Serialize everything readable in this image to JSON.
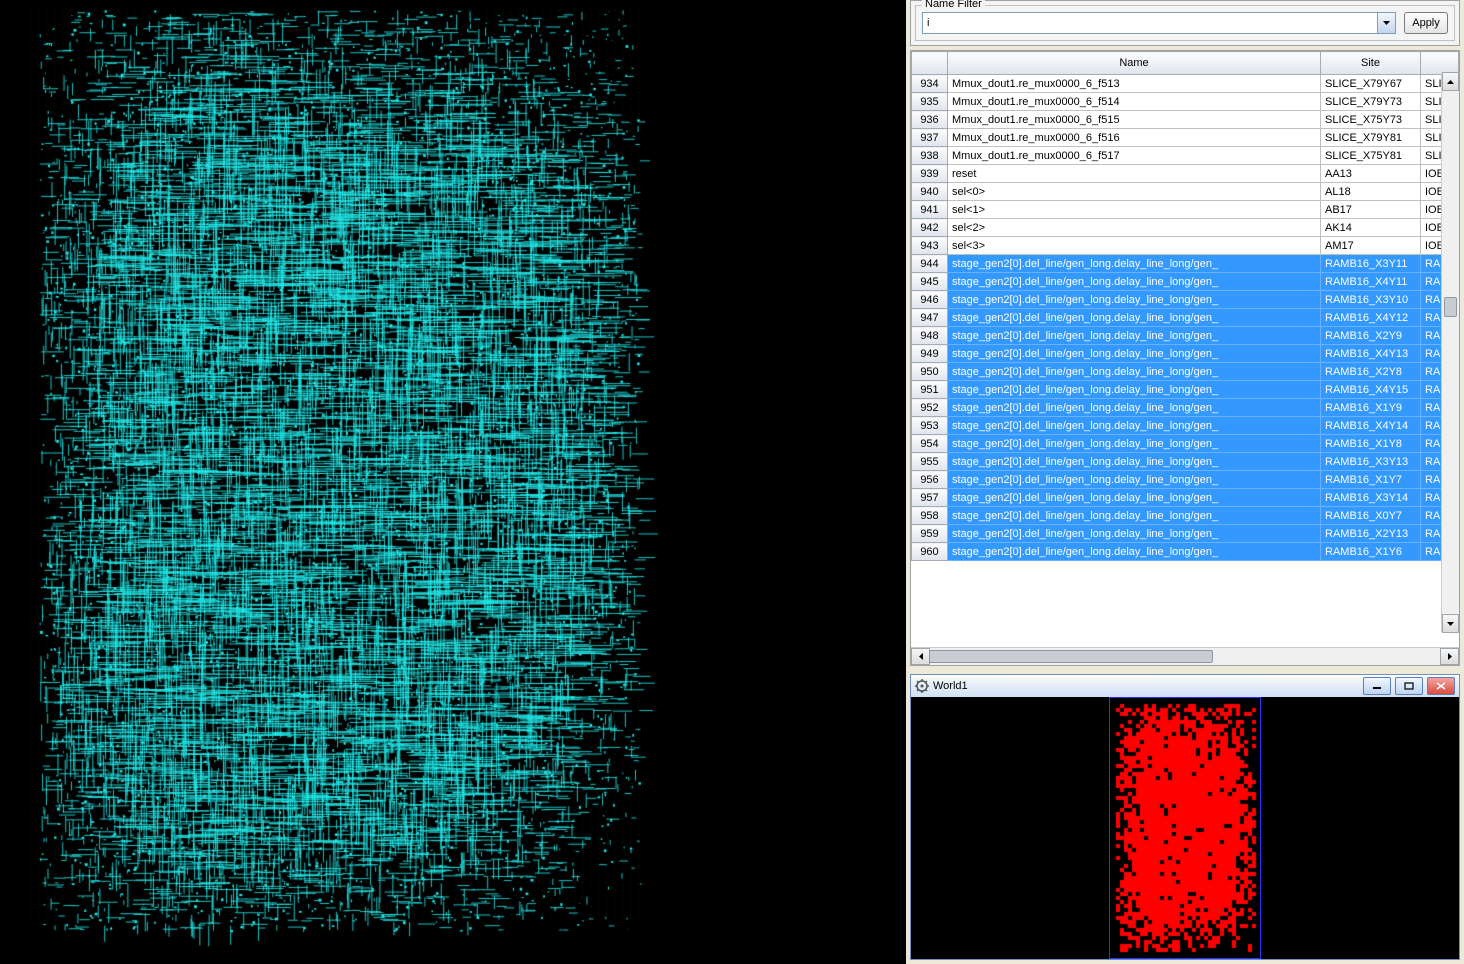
{
  "filter": {
    "legend": "Name Filter",
    "value": "i",
    "apply_label": "Apply"
  },
  "table": {
    "headers": {
      "name": "Name",
      "site": "Site",
      "type": ""
    },
    "rows": [
      {
        "n": 934,
        "name": "Mmux_dout1.re_mux0000_6_f513",
        "site": "SLICE_X79Y67",
        "type": "SLICI",
        "sel": false
      },
      {
        "n": 935,
        "name": "Mmux_dout1.re_mux0000_6_f514",
        "site": "SLICE_X79Y73",
        "type": "SLICI",
        "sel": false
      },
      {
        "n": 936,
        "name": "Mmux_dout1.re_mux0000_6_f515",
        "site": "SLICE_X75Y73",
        "type": "SLICI",
        "sel": false
      },
      {
        "n": 937,
        "name": "Mmux_dout1.re_mux0000_6_f516",
        "site": "SLICE_X79Y81",
        "type": "SLICI",
        "sel": false
      },
      {
        "n": 938,
        "name": "Mmux_dout1.re_mux0000_6_f517",
        "site": "SLICE_X75Y81",
        "type": "SLICI",
        "sel": false
      },
      {
        "n": 939,
        "name": "reset",
        "site": "AA13",
        "type": "IOB",
        "sel": false
      },
      {
        "n": 940,
        "name": "sel<0>",
        "site": "AL18",
        "type": "IOB",
        "sel": false
      },
      {
        "n": 941,
        "name": "sel<1>",
        "site": "AB17",
        "type": "IOB",
        "sel": false
      },
      {
        "n": 942,
        "name": "sel<2>",
        "site": "AK14",
        "type": "IOB",
        "sel": false
      },
      {
        "n": 943,
        "name": "sel<3>",
        "site": "AM17",
        "type": "IOB",
        "sel": false
      },
      {
        "n": 944,
        "name": "stage_gen2[0].del_line/gen_long.delay_line_long/gen_",
        "site": "RAMB16_X3Y11",
        "type": "RAM",
        "sel": true
      },
      {
        "n": 945,
        "name": "stage_gen2[0].del_line/gen_long.delay_line_long/gen_",
        "site": "RAMB16_X4Y11",
        "type": "RAM",
        "sel": true
      },
      {
        "n": 946,
        "name": "stage_gen2[0].del_line/gen_long.delay_line_long/gen_",
        "site": "RAMB16_X3Y10",
        "type": "RAM",
        "sel": true
      },
      {
        "n": 947,
        "name": "stage_gen2[0].del_line/gen_long.delay_line_long/gen_",
        "site": "RAMB16_X4Y12",
        "type": "RAM",
        "sel": true
      },
      {
        "n": 948,
        "name": "stage_gen2[0].del_line/gen_long.delay_line_long/gen_",
        "site": "RAMB16_X2Y9",
        "type": "RAM",
        "sel": true
      },
      {
        "n": 949,
        "name": "stage_gen2[0].del_line/gen_long.delay_line_long/gen_",
        "site": "RAMB16_X4Y13",
        "type": "RAM",
        "sel": true
      },
      {
        "n": 950,
        "name": "stage_gen2[0].del_line/gen_long.delay_line_long/gen_",
        "site": "RAMB16_X2Y8",
        "type": "RAM",
        "sel": true
      },
      {
        "n": 951,
        "name": "stage_gen2[0].del_line/gen_long.delay_line_long/gen_",
        "site": "RAMB16_X4Y15",
        "type": "RAM",
        "sel": true
      },
      {
        "n": 952,
        "name": "stage_gen2[0].del_line/gen_long.delay_line_long/gen_",
        "site": "RAMB16_X1Y9",
        "type": "RAM",
        "sel": true
      },
      {
        "n": 953,
        "name": "stage_gen2[0].del_line/gen_long.delay_line_long/gen_",
        "site": "RAMB16_X4Y14",
        "type": "RAM",
        "sel": true
      },
      {
        "n": 954,
        "name": "stage_gen2[0].del_line/gen_long.delay_line_long/gen_",
        "site": "RAMB16_X1Y8",
        "type": "RAM",
        "sel": true
      },
      {
        "n": 955,
        "name": "stage_gen2[0].del_line/gen_long.delay_line_long/gen_",
        "site": "RAMB16_X3Y13",
        "type": "RAM",
        "sel": true
      },
      {
        "n": 956,
        "name": "stage_gen2[0].del_line/gen_long.delay_line_long/gen_",
        "site": "RAMB16_X1Y7",
        "type": "RAM",
        "sel": true
      },
      {
        "n": 957,
        "name": "stage_gen2[0].del_line/gen_long.delay_line_long/gen_",
        "site": "RAMB16_X3Y14",
        "type": "RAM",
        "sel": true
      },
      {
        "n": 958,
        "name": "stage_gen2[0].del_line/gen_long.delay_line_long/gen_",
        "site": "RAMB16_X0Y7",
        "type": "RAM",
        "sel": true
      },
      {
        "n": 959,
        "name": "stage_gen2[0].del_line/gen_long.delay_line_long/gen_",
        "site": "RAMB16_X2Y13",
        "type": "RAM",
        "sel": true
      },
      {
        "n": 960,
        "name": "stage_gen2[0].del_line/gen_long.delay_line_long/gen_",
        "site": "RAMB16_X1Y6",
        "type": "RAM",
        "sel": true
      }
    ]
  },
  "world": {
    "title": "World1"
  },
  "colors": {
    "routing": "#21e6e6",
    "placement": "#ff0000",
    "selected_row": "#3399ff",
    "overview_border": "#3030ff"
  }
}
